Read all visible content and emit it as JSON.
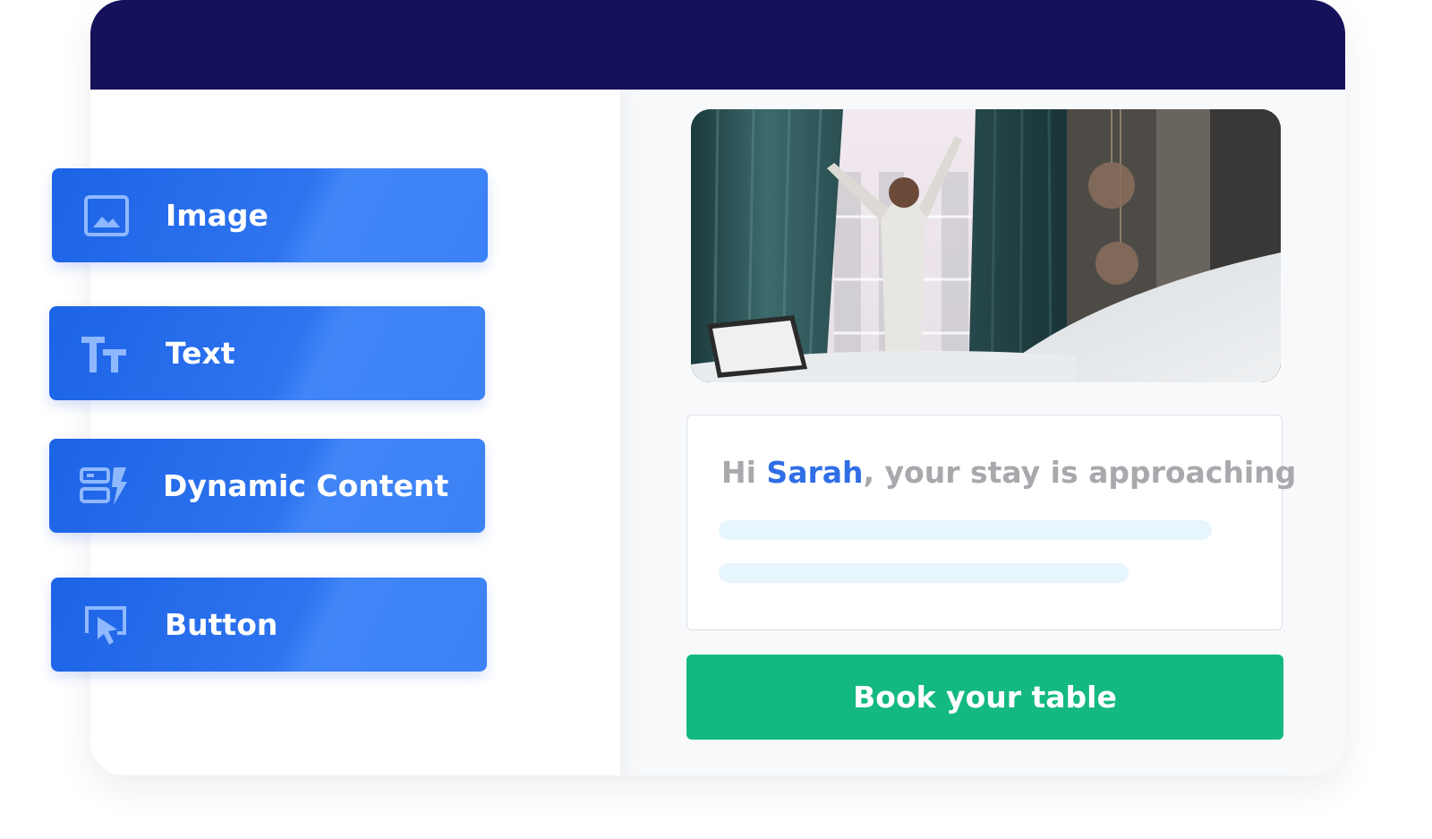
{
  "colors": {
    "header_bg": "#15115a",
    "block_blue": "#2a6ef0",
    "cta_green": "#14b982",
    "name_blue": "#2f6ee6",
    "greeting_gray": "#a7a9ad",
    "placeholder_line": "#e7f5fd"
  },
  "blocks": [
    {
      "label": "Image",
      "icon": "image-icon"
    },
    {
      "label": "Text",
      "icon": "text-size-icon"
    },
    {
      "label": "Dynamic Content",
      "icon": "dynamic-content-icon"
    },
    {
      "label": "Button",
      "icon": "cursor-click-icon"
    }
  ],
  "preview": {
    "hero_image": "hotel-room-morning-photo",
    "greeting_prefix": "Hi ",
    "greeting_name": "Sarah",
    "greeting_suffix": ", your stay is approaching",
    "cta_label": "Book your table"
  }
}
